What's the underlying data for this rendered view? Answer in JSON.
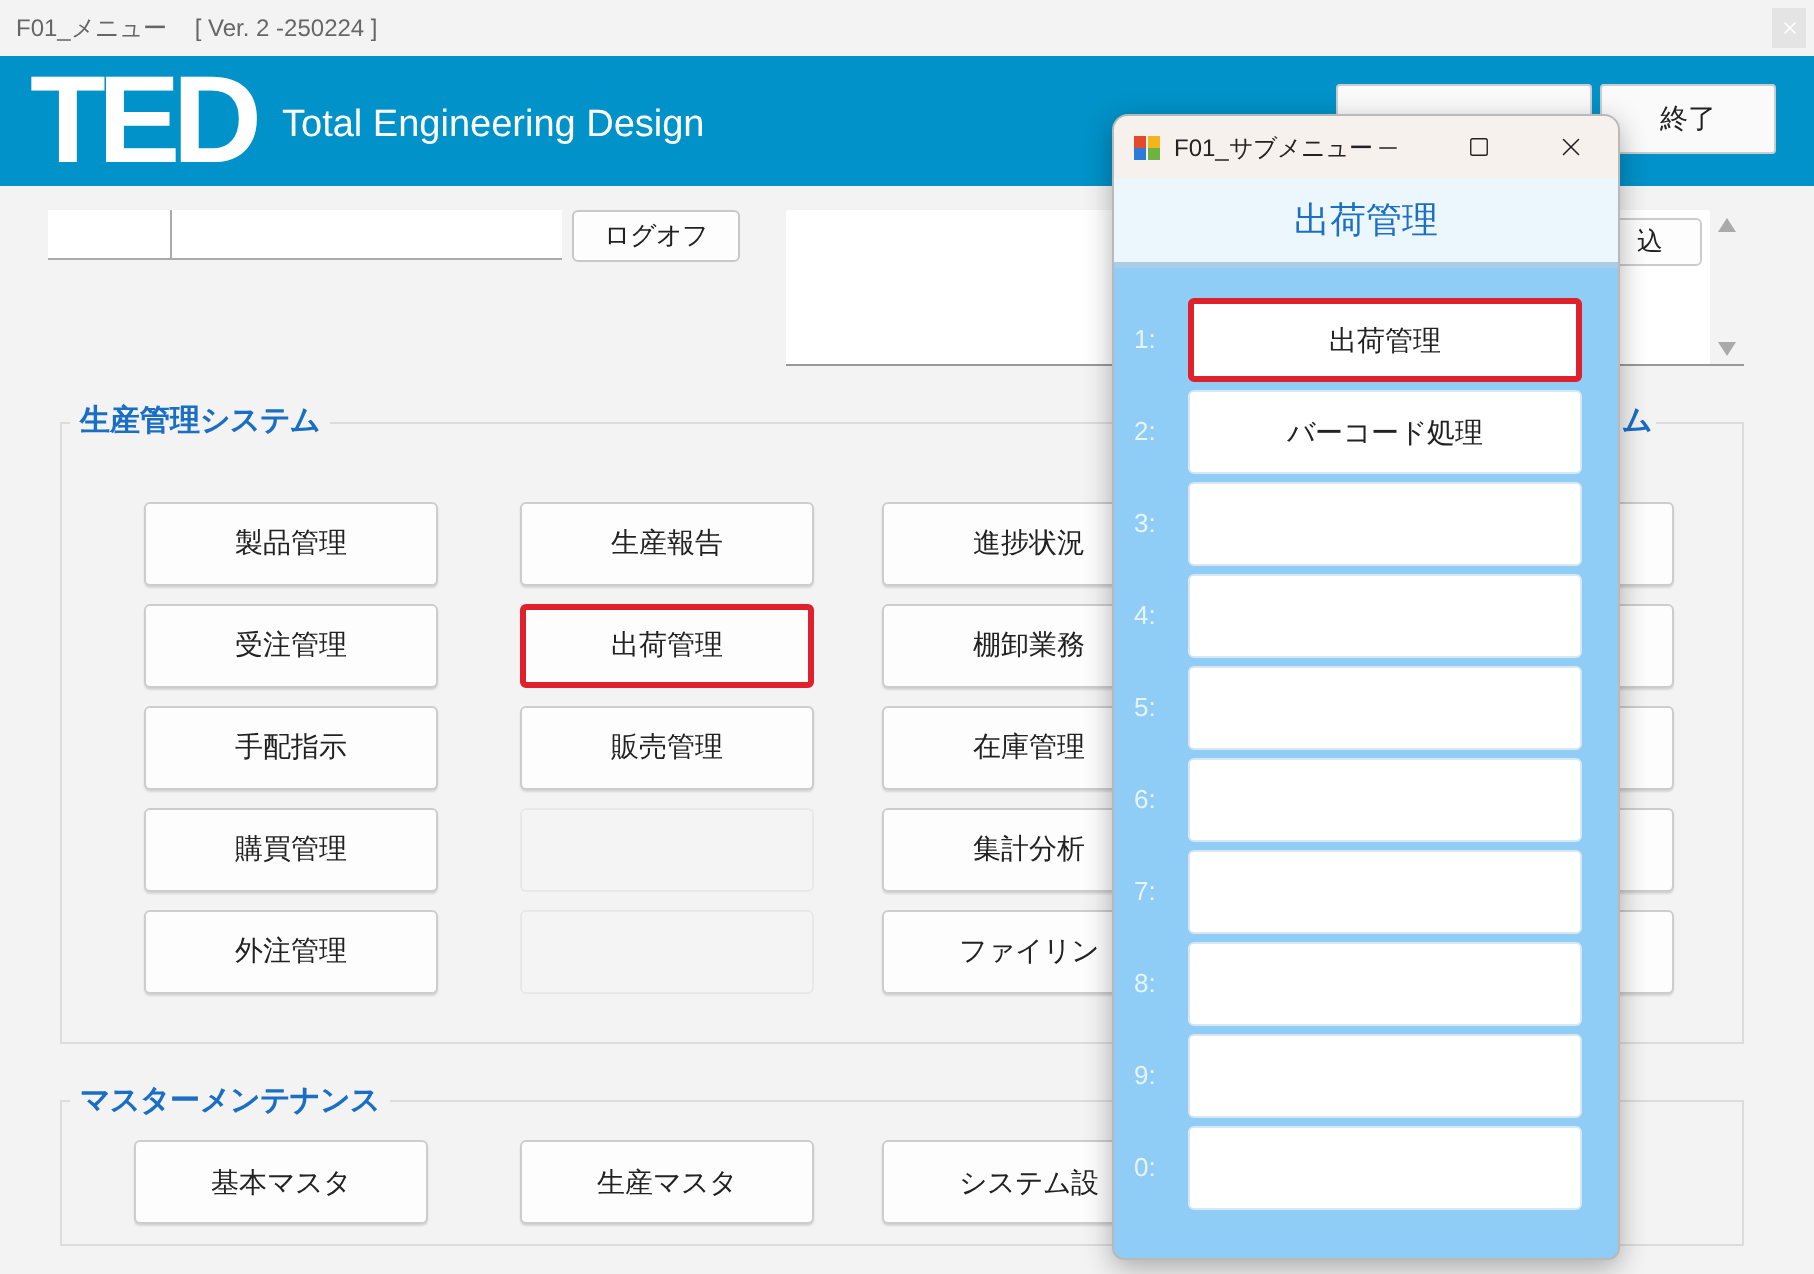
{
  "window": {
    "title": "F01_メニュー",
    "version": "[ Ver. 2 -250224 ]"
  },
  "header": {
    "logo": "TED",
    "tagline": "Total Engineering Design",
    "buttons": [
      {
        "kind": "covered"
      },
      {
        "kind": "labeled",
        "label": "終了"
      }
    ]
  },
  "login": {
    "logoff_button": "ログオフ"
  },
  "memo": {
    "button": "込"
  },
  "production_group": {
    "title": "生産管理システム",
    "columns": [
      [
        {
          "label": "製品管理",
          "enabled": true,
          "selected": false
        },
        {
          "label": "受注管理",
          "enabled": true,
          "selected": false
        },
        {
          "label": "手配指示",
          "enabled": true,
          "selected": false
        },
        {
          "label": "購買管理",
          "enabled": true,
          "selected": false
        },
        {
          "label": "外注管理",
          "enabled": true,
          "selected": false
        }
      ],
      [
        {
          "label": "生産報告",
          "enabled": true,
          "selected": false
        },
        {
          "label": "出荷管理",
          "enabled": true,
          "selected": true
        },
        {
          "label": "販売管理",
          "enabled": true,
          "selected": false
        },
        {
          "enabled": false,
          "selected": false
        },
        {
          "enabled": false,
          "selected": false
        }
      ],
      [
        {
          "label": "進捗状況",
          "enabled": true,
          "selected": false
        },
        {
          "label": "棚卸業務",
          "enabled": true,
          "selected": false
        },
        {
          "label": "在庫管理",
          "enabled": true,
          "selected": false
        },
        {
          "label": "集計分析",
          "enabled": true,
          "selected": false
        },
        {
          "label": "ファイリン",
          "enabled": true,
          "selected": false
        }
      ]
    ]
  },
  "side_group": {
    "title": "ム",
    "buttons": [
      {
        "enabled": true
      },
      {
        "enabled": true
      },
      {
        "enabled": true
      },
      {
        "enabled": true
      },
      {
        "enabled": true
      }
    ]
  },
  "master_group": {
    "title": "マスターメンテナンス",
    "buttons": [
      {
        "label": "基本マスタ"
      },
      {
        "label": "生産マスタ"
      },
      {
        "label": "システム設"
      }
    ]
  },
  "sub_window": {
    "title": "F01_サブメニュー",
    "heading": "出荷管理",
    "items": [
      {
        "number": "1:",
        "label": "出荷管理",
        "selected": true
      },
      {
        "number": "2:",
        "label": "バーコード処理",
        "selected": false
      },
      {
        "number": "3:",
        "selected": false
      },
      {
        "number": "4:",
        "selected": false
      },
      {
        "number": "5:",
        "selected": false
      },
      {
        "number": "6:",
        "selected": false
      },
      {
        "number": "7:",
        "selected": false
      },
      {
        "number": "8:",
        "selected": false
      },
      {
        "number": "9:",
        "selected": false
      },
      {
        "number": "0:",
        "selected": false
      }
    ]
  }
}
